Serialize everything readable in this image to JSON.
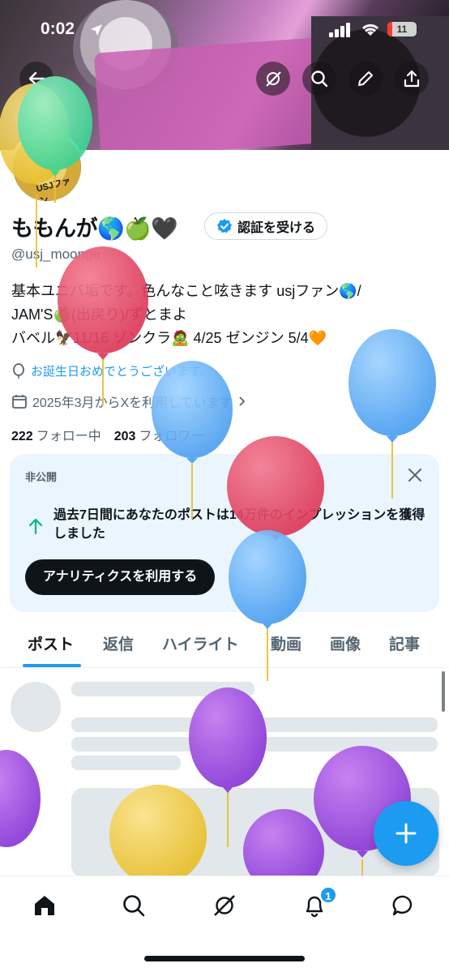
{
  "status": {
    "time": "0:02",
    "battery": "11"
  },
  "profile": {
    "name": "ももんが🌎🍏🖤",
    "verify_label": "認証を受ける",
    "handle": "@usj_moonga",
    "avatar_text": "USJファン",
    "bio_lines": [
      "基本ユニバ垢です。色んなこと呟きます usjファン🌎/",
      "JAM'S🍏(出戻り)/ずとまよ",
      "バベル🦅11/16 ゾンクラ🧟 4/25 ゼンジン 5/4🧡"
    ],
    "birthday_text": "お誕生日おめでとうございます。",
    "joined_text": "2025年3月からXを利用しています",
    "following_count": "222",
    "following_label": "フォロー中",
    "followers_count": "203",
    "followers_label": "フォロワー"
  },
  "analytics_card": {
    "private_label": "非公開",
    "message": "過去7日間にあなたのポストは14万件のインプレッションを獲得しました",
    "cta_label": "アナリティクスを利用する"
  },
  "tabs": [
    "ポスト",
    "返信",
    "ハイライト",
    "動画",
    "画像",
    "記事"
  ],
  "active_tab": "ポスト",
  "notifications_badge": "1",
  "colors": {
    "accent": "#1d9bf0",
    "text": "#0f1419",
    "muted": "#536471",
    "card_bg": "#eaf5fd"
  },
  "icons": {
    "header": [
      "back-arrow-icon",
      "grok-icon",
      "search-icon",
      "edit-pencil-icon",
      "share-icon"
    ],
    "bottom_nav": [
      "home-icon",
      "search-icon",
      "grok-icon",
      "notifications-bell-icon",
      "messages-icon"
    ],
    "fab": "plus-icon"
  }
}
